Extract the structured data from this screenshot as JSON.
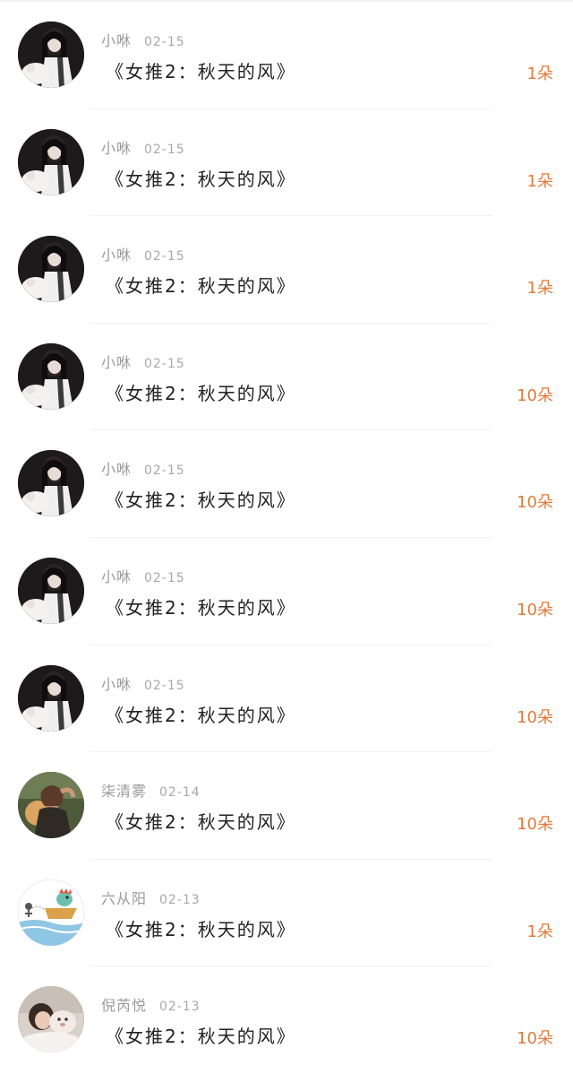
{
  "gifts": [
    {
      "user": "小咻",
      "date": "02-15",
      "title": "《女推2：秋天的风》",
      "amount": "1朵",
      "avatar": "girl-dark"
    },
    {
      "user": "小咻",
      "date": "02-15",
      "title": "《女推2：秋天的风》",
      "amount": "1朵",
      "avatar": "girl-dark"
    },
    {
      "user": "小咻",
      "date": "02-15",
      "title": "《女推2：秋天的风》",
      "amount": "1朵",
      "avatar": "girl-dark"
    },
    {
      "user": "小咻",
      "date": "02-15",
      "title": "《女推2：秋天的风》",
      "amount": "10朵",
      "avatar": "girl-dark"
    },
    {
      "user": "小咻",
      "date": "02-15",
      "title": "《女推2：秋天的风》",
      "amount": "10朵",
      "avatar": "girl-dark"
    },
    {
      "user": "小咻",
      "date": "02-15",
      "title": "《女推2：秋天的风》",
      "amount": "10朵",
      "avatar": "girl-dark"
    },
    {
      "user": "小咻",
      "date": "02-15",
      "title": "《女推2：秋天的风》",
      "amount": "10朵",
      "avatar": "girl-dark"
    },
    {
      "user": "柒清雾",
      "date": "02-14",
      "title": "《女推2：秋天的风》",
      "amount": "10朵",
      "avatar": "girl-sunset"
    },
    {
      "user": "六从阳",
      "date": "02-13",
      "title": "《女推2：秋天的风》",
      "amount": "1朵",
      "avatar": "cartoon-boat"
    },
    {
      "user": "倪芮悦",
      "date": "02-13",
      "title": "《女推2：秋天的风》",
      "amount": "10朵",
      "avatar": "girl-pet"
    }
  ],
  "colors": {
    "amount": "#e07b3c",
    "meta": "#9a9a9a",
    "title": "#222222",
    "divider": "#f1f1f1"
  }
}
